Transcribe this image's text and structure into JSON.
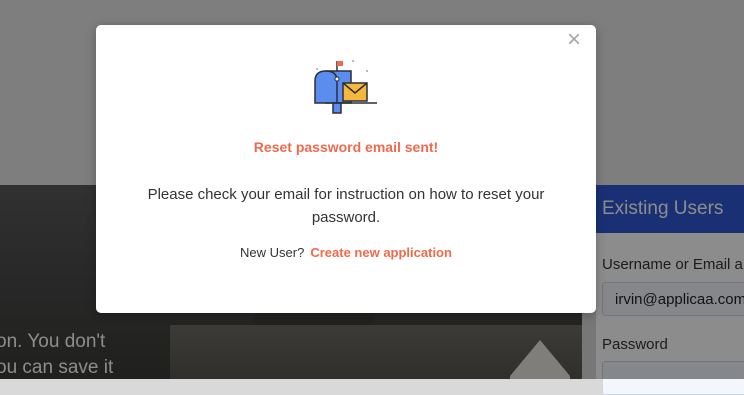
{
  "background": {
    "hero_lines": [
      "on. You don't",
      "ou can save it"
    ],
    "login": {
      "header": "Existing Users",
      "username_label": "Username or Email a",
      "username_value": "irvin@applicaa.com",
      "password_label": "Password"
    }
  },
  "modal": {
    "close_glyph": "×",
    "icon": "mailbox-with-envelope-icon",
    "title": "Reset password email sent!",
    "message": "Please check your email for instruction on how to reset your password.",
    "footer_prompt": "New User?",
    "footer_link": "Create new application"
  },
  "colors": {
    "accent": "#ef6a4c",
    "login_header": "#2e58d6",
    "mailbox_blue": "#5b8def",
    "envelope": "#f5b83d"
  }
}
